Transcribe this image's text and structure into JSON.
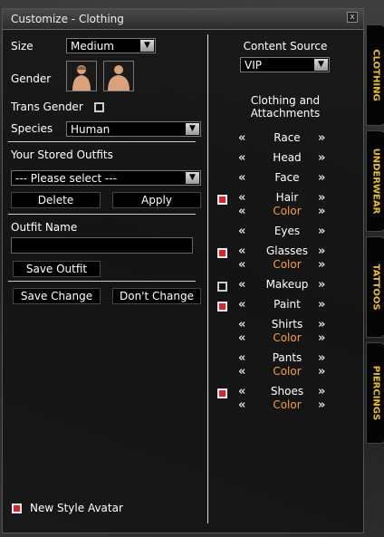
{
  "window": {
    "title": "Customize - Clothing",
    "close_glyph": "x"
  },
  "left": {
    "size_label": "Size",
    "size_value": "Medium",
    "gender_label": "Gender",
    "trans_gender_label": "Trans Gender",
    "trans_gender_checked": false,
    "species_label": "Species",
    "species_value": "Human",
    "stored_outfits_label": "Your Stored Outfits",
    "stored_outfits_value": "--- Please select ---",
    "delete_label": "Delete",
    "apply_label": "Apply",
    "outfit_name_label": "Outfit Name",
    "outfit_name_value": "",
    "save_outfit_label": "Save Outfit",
    "save_change_label": "Save Change",
    "dont_change_label": "Don't Change",
    "new_style_avatar_label": "New Style Avatar",
    "new_style_avatar_checked": true
  },
  "right": {
    "content_source_label": "Content Source",
    "content_source_value": "VIP",
    "clothing_heading_line1": "Clothing and",
    "clothing_heading_line2": "Attachments",
    "color_label": "Color",
    "items": [
      {
        "name": "Race"
      },
      {
        "name": "Head"
      },
      {
        "name": "Face"
      },
      {
        "name": "Hair",
        "has_color": true,
        "checked": true
      },
      {
        "name": "Eyes"
      },
      {
        "name": "Glasses",
        "has_color": true,
        "checked": true
      },
      {
        "name": "Makeup",
        "checked": false
      },
      {
        "name": "Paint",
        "checked": true
      },
      {
        "name": "Shirts",
        "has_color": true
      },
      {
        "name": "Pants",
        "has_color": true
      },
      {
        "name": "Shoes",
        "has_color": true,
        "checked": true
      }
    ]
  },
  "tabs": [
    "CLOTHING",
    "UNDERWEAR",
    "TATTOOS",
    "PIERCINGS"
  ],
  "colors": {
    "accent_tab": "#f0c020",
    "color_label": "#f0a040",
    "checkbox_on": "#d8232a"
  }
}
